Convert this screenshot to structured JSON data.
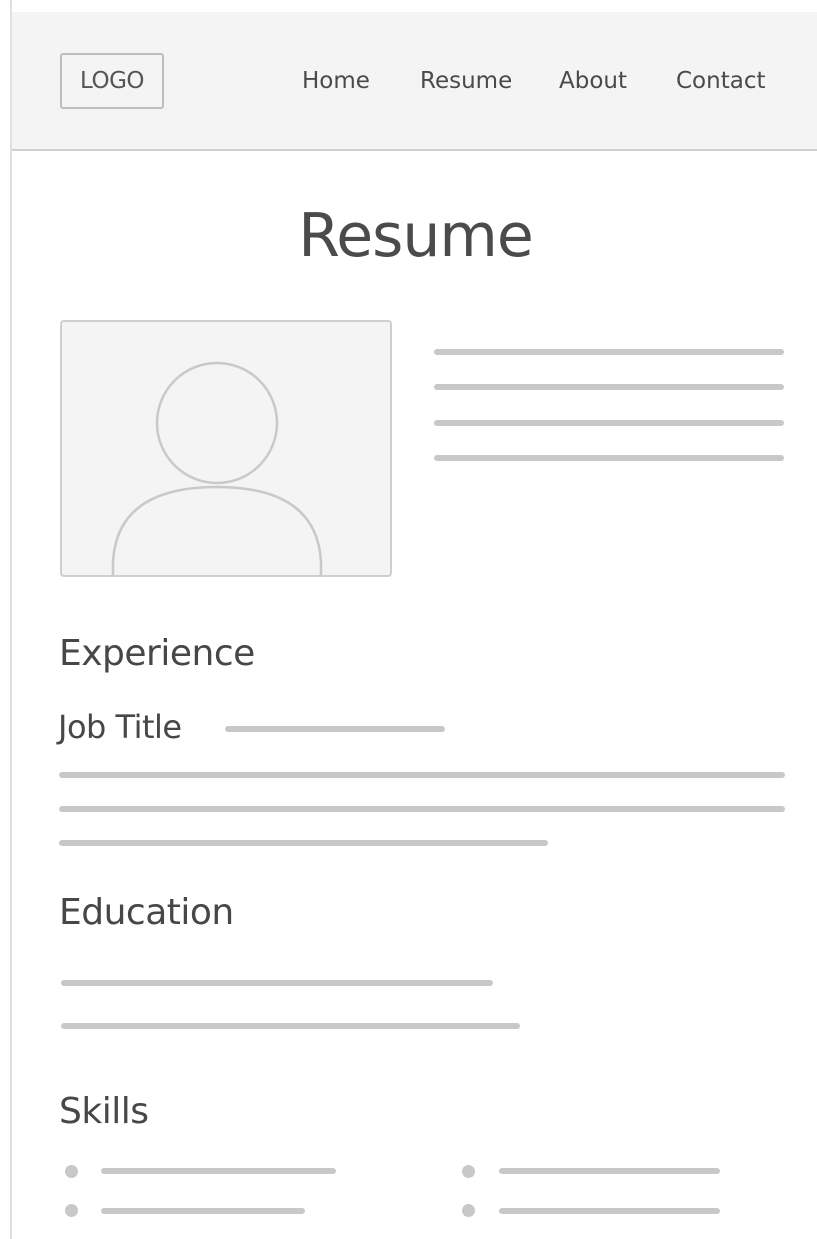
{
  "header": {
    "logo": "LOGO",
    "nav": [
      {
        "label": "Home"
      },
      {
        "label": "Resume"
      },
      {
        "label": "About"
      },
      {
        "label": "Contact"
      }
    ]
  },
  "main": {
    "title": "Resume",
    "profile_photo_icon": "user-avatar-placeholder-icon",
    "sections": {
      "experience": {
        "heading": "Experience",
        "job_title": "Job Title"
      },
      "education": {
        "heading": "Education"
      },
      "skills": {
        "heading": "Skills"
      }
    }
  },
  "colors": {
    "header_bg": "#f4f4f4",
    "placeholder_line": "#c8c8c8",
    "text": "#4a4a4a",
    "border": "#cfcfcf"
  }
}
